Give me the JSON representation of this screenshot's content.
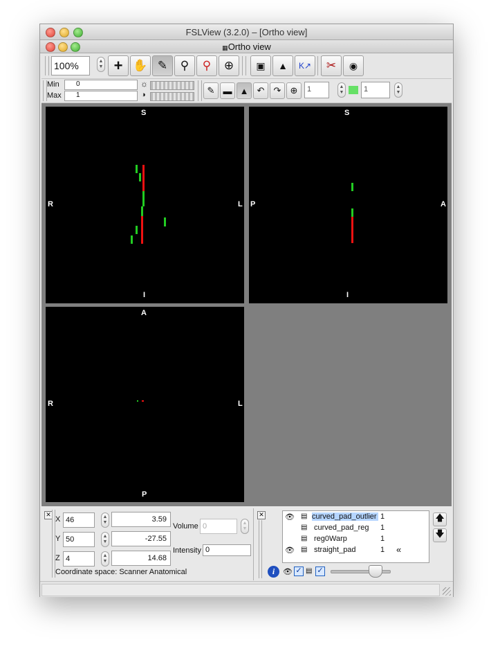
{
  "window": {
    "title": "FSLView (3.2.0) – [Ortho view]",
    "subtitle": "Ortho view"
  },
  "toolbar": {
    "zoom_value": "100%",
    "tools": [
      "cross-cursor",
      "pan-hand",
      "pencil-draw",
      "zoom-magnifier",
      "zoom-out-magnifier",
      "crosshair-target",
      "chip-voxel",
      "hand-stamp",
      "kt-arrows",
      "scissors-cut",
      "camera-snapshot"
    ]
  },
  "toolbar2": {
    "min_label": "Min",
    "min_value": "0",
    "max_label": "Max",
    "max_value": "1",
    "value_field_1": "1",
    "value_field_2": "1",
    "fill_color": "#66e066"
  },
  "viewports": {
    "coronal": {
      "top": "S",
      "bottom": "I",
      "left": "R",
      "right": "L"
    },
    "sagittal": {
      "top": "S",
      "bottom": "I",
      "left": "P",
      "right": "A"
    },
    "axial": {
      "top": "A",
      "bottom": "P",
      "left": "R",
      "right": "L"
    },
    "overlay_colors": {
      "green": "#22cc22",
      "red": "#ee1111"
    }
  },
  "cursor": {
    "x_label": "X",
    "x_voxel": "46",
    "x_mm": "3.59",
    "y_label": "Y",
    "y_voxel": "50",
    "y_mm": "-27.55",
    "z_label": "Z",
    "z_voxel": "4",
    "z_mm": "14.68",
    "volume_label": "Volume",
    "volume_value": "0",
    "intensity_label": "Intensity",
    "intensity_value": "0",
    "coordinate_space": "Coordinate space: Scanner Anatomical"
  },
  "layers": [
    {
      "name": "curved_pad_outlier",
      "value": "1",
      "visible": true,
      "selected": true,
      "extra": ""
    },
    {
      "name": "curved_pad_reg",
      "value": "1",
      "visible": false,
      "selected": false,
      "extra": ""
    },
    {
      "name": "reg0Warp",
      "value": "1",
      "visible": false,
      "selected": false,
      "extra": ""
    },
    {
      "name": "straight_pad",
      "value": "1",
      "visible": true,
      "selected": false,
      "extra": "«"
    }
  ],
  "layer_controls": {
    "opacity": 0.75
  }
}
